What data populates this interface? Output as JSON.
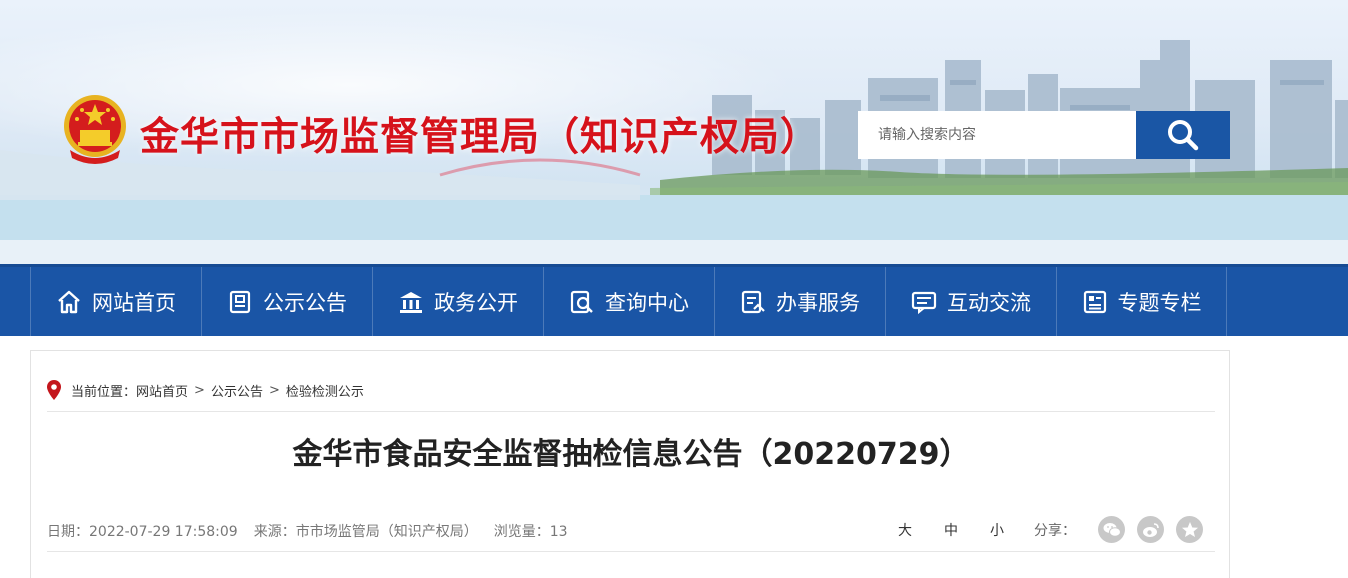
{
  "header": {
    "site_title": "金华市市场监督管理局（知识产权局）",
    "search_placeholder": "请输入搜索内容",
    "brand_red": "#d6121b",
    "brand_blue": "#1a55a6"
  },
  "nav": {
    "items": [
      {
        "label": "网站首页",
        "icon": "home-icon"
      },
      {
        "label": "公示公告",
        "icon": "notice-icon"
      },
      {
        "label": "政务公开",
        "icon": "government-icon"
      },
      {
        "label": "查询中心",
        "icon": "query-icon"
      },
      {
        "label": "办事服务",
        "icon": "service-icon"
      },
      {
        "label": "互动交流",
        "icon": "chat-icon"
      },
      {
        "label": "专题专栏",
        "icon": "column-icon"
      }
    ]
  },
  "breadcrumb": {
    "prefix": "当前位置：",
    "items": [
      "网站首页",
      "公示公告",
      "检验检测公示"
    ],
    "separator": ">"
  },
  "article": {
    "title": "金华市食品安全监督抽检信息公告（20220729）",
    "date": "日期：2022-07-29 17:58:09",
    "source": "来源：市市场监管局（知识产权局）",
    "views": "浏览量：13"
  },
  "tools": {
    "font_large": "大",
    "font_medium": "中",
    "font_small": "小",
    "share_label": "分享：",
    "share_icons": [
      "wechat-icon",
      "weibo-icon",
      "qzone-icon"
    ]
  }
}
